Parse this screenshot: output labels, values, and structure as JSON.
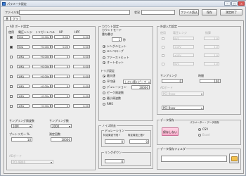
{
  "window": {
    "title": "パラメータ設定"
  },
  "topbar": {
    "file_label": "ファイル名",
    "file_value": "",
    "status_label": "状況",
    "status_value": "",
    "load_button": "ファイル読込",
    "save_button": "保存",
    "stop_button": "測定終了"
  },
  "tabs": [
    {
      "label": "基"
    },
    {
      "label": "グラフ"
    }
  ],
  "ad": {
    "title": "AD ボード設定",
    "headers": [
      "使用",
      "電圧レンジ",
      "トリガーレベル",
      "UP",
      "HPF"
    ],
    "rows": [
      {
        "on": true,
        "range": "50Ω",
        "trig": "+0.00v",
        "up": "0.00",
        "hpf": "0.00"
      },
      {
        "on": true,
        "range": "50Ω",
        "trig": "+0.00v",
        "up": "0.00",
        "hpf": "0.00"
      },
      {
        "on": false,
        "range": "1MΩ",
        "trig": "+0.00v",
        "up": "0",
        "hpf": "0.00"
      },
      {
        "on": false,
        "range": "1MΩ",
        "trig": "+0.00v",
        "up": "0",
        "hpf": "0.00"
      },
      {
        "on": false,
        "range": "1MΩ",
        "trig": "+0.00v",
        "up": "0",
        "hpf": "0.00"
      },
      {
        "on": false,
        "range": "1MΩ",
        "trig": "+0.00v",
        "up": "0",
        "hpf": "0.00"
      },
      {
        "on": false,
        "range": "1MΩ",
        "trig": "+0.00v",
        "up": "0",
        "hpf": "0.00"
      },
      {
        "on": false,
        "range": "1MΩ",
        "trig": "+0.00v",
        "up": "0",
        "hpf": "0.00"
      }
    ],
    "sampling_freq_label": "サンプリング周波数",
    "sampling_freq_value": "10M",
    "sampling_count_label": "サンプリング数",
    "sampling_count_value": "2000",
    "pretrigger_label": "プレトリガー %",
    "pretrigger_value": "10",
    "trig_cnt_label": "測定回数",
    "trig_cnt_value": "10000",
    "board_label": "ADボード",
    "board_value": "PCI-9846"
  },
  "count": {
    "title": "カウント設定",
    "subtitle": "カウントモード",
    "count_type_label": "重ね書き",
    "count_value": "1",
    "count_unit": "秒",
    "modes": [
      {
        "label": "シングルヒット",
        "on": true
      },
      {
        "label": "エンベロープ",
        "on": false
      },
      {
        "label": "ファーストヒット",
        "on": false
      },
      {
        "label": "オートセット",
        "on": true
      }
    ]
  },
  "trigger": {
    "title": "トリガ設定",
    "options": [
      {
        "label": "最大値",
        "on": true
      },
      {
        "label": "平均値",
        "on": false
      },
      {
        "label": "デュレーション",
        "on": false
      },
      {
        "label": "ピーク周波数",
        "on": false
      },
      {
        "label": "最小周波数",
        "on": false
      },
      {
        "label": "RMS",
        "on": false
      }
    ],
    "method_value": "しきい値+ピーク",
    "threshold_label": "デュレーション",
    "threshold_value": "20000"
  },
  "noise": {
    "title": "ノイズ除去",
    "duration_label": "デュレーション",
    "low_label": "特定周波下限 f",
    "high_label": "特定周波上限 f",
    "low_value": "0",
    "high_value": "0",
    "ring_label": "リングダウン",
    "ring_value": "0"
  },
  "ext": {
    "title": "外部入力設定",
    "headers": [
      "使用",
      "電圧レンジ",
      "換算"
    ],
    "rows": [
      {
        "range": "0V1",
        "factor": "1.0"
      },
      {
        "range": "±10V",
        "factor": "1.0"
      },
      {
        "range": "±10V",
        "factor": "1.0"
      },
      {
        "range": "0V1",
        "factor": "1.0"
      }
    ],
    "sampling_label": "サンプリング",
    "sampling_value": "0",
    "time_label": "時間",
    "time_value": "100",
    "board_label": "ADボード",
    "board_value": "PCI-9xxx",
    "board2_label": "",
    "board2_value": "PCI-9xxx",
    "board3_value": "PCI-9xxx"
  },
  "data": {
    "title": "データ保存",
    "save_type_label": "パラメーター・データ保存",
    "save_button": "保存しない",
    "csv_label": "CSV",
    "bin_label": "Excel",
    "folder_label": "データ保存フォルダ",
    "folder_value": ""
  }
}
